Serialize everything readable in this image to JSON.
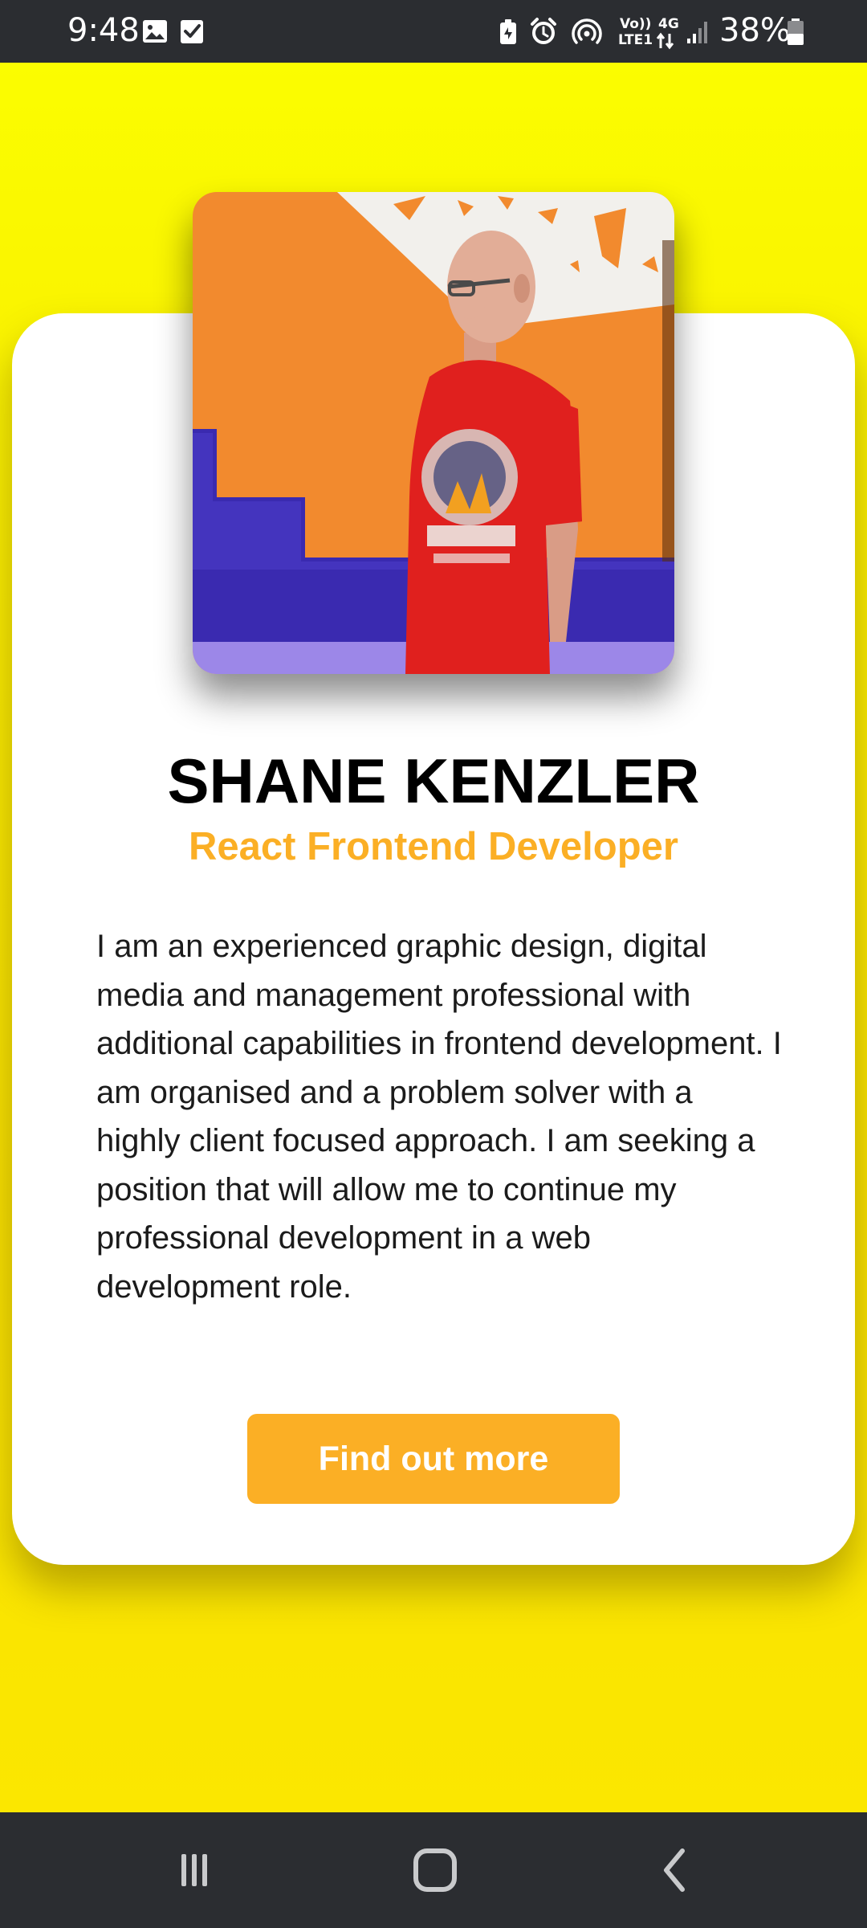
{
  "status_bar": {
    "time": "9:48",
    "network_label_top": "Vo))",
    "network_label_bottom": "LTE1",
    "network_type": "4G",
    "battery": "38%",
    "icons": [
      "image-icon",
      "check-square-icon",
      "battery-saver-icon",
      "alarm-icon",
      "hotspot-icon",
      "volte-icon",
      "data-arrows-icon",
      "signal-icon",
      "battery-icon"
    ]
  },
  "profile": {
    "name": "SHANE KENZLER",
    "role": "React Frontend Developer",
    "bio": "I am an experienced graphic design, digital media and management professional with additional capabilities in frontend development. I am organised and a problem solver with a highly client focused approach. I am seeking a position that will allow me to continue my professional development in a web development role.",
    "cta_label": "Find out more",
    "photo_icon": "profile-photo"
  },
  "nav_bar": {
    "icons": [
      "recent-apps-icon",
      "home-icon",
      "back-icon"
    ]
  },
  "colors": {
    "accent": "#fbaf25",
    "background_top": "#fbfd00",
    "background_bottom": "#fbe700",
    "card": "#ffffff",
    "system_bar": "#2b2d31"
  }
}
